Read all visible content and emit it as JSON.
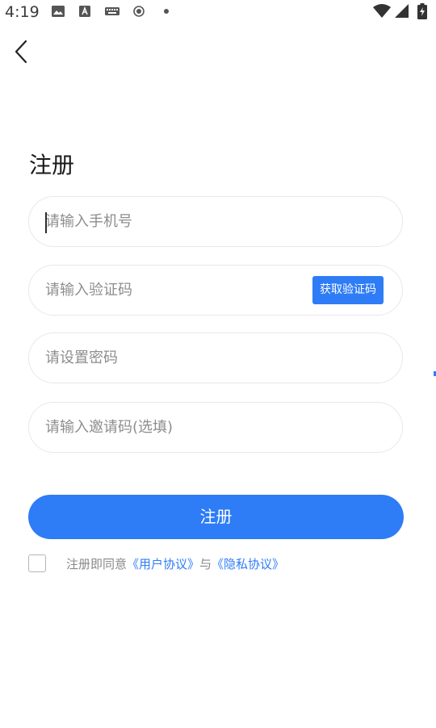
{
  "status_bar": {
    "time": "4:19",
    "icons": [
      "image-icon",
      "a-icon",
      "keyboard-icon",
      "record-icon",
      "dot-icon",
      "wifi-icon",
      "signal-icon",
      "battery-icon"
    ]
  },
  "header": {
    "back_icon": "chevron-left-icon"
  },
  "title": "注册",
  "form": {
    "phone_placeholder": "请输入手机号",
    "code_placeholder": "请输入验证码",
    "get_code_label": "获取验证码",
    "password_placeholder": "请设置密码",
    "invite_placeholder": "请输入邀请码(选填)"
  },
  "register_label": "注册",
  "agreement": {
    "prefix": "注册即同意",
    "user_agreement": "《用户协议》",
    "and": "与",
    "privacy_policy": "《隐私协议》"
  },
  "colors": {
    "accent": "#2e7cf6",
    "border": "#e8e8e8",
    "placeholder": "#8d8d8d"
  }
}
